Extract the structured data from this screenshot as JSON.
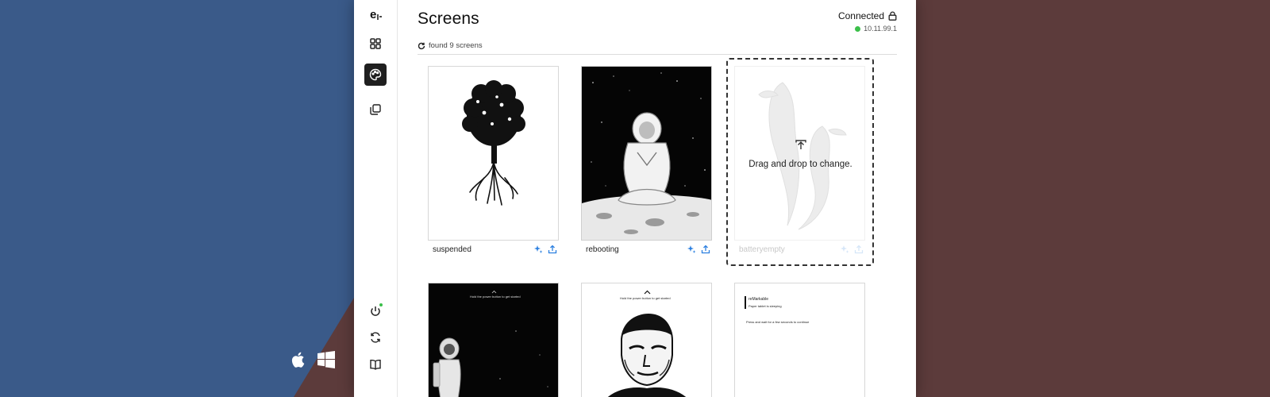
{
  "header": {
    "title": "Screens",
    "connection_status": "Connected",
    "ip_address": "10.11.99.1",
    "found_text": "found 9 screens"
  },
  "sidebar": {
    "items": [
      {
        "name": "logo",
        "icon": "app-logo-icon"
      },
      {
        "name": "dashboard",
        "icon": "grid-icon"
      },
      {
        "name": "screens",
        "icon": "palette-icon",
        "active": true
      },
      {
        "name": "templates",
        "icon": "copy-icon"
      },
      {
        "name": "power",
        "icon": "power-icon"
      },
      {
        "name": "sync",
        "icon": "sync-icon"
      },
      {
        "name": "docs",
        "icon": "book-icon"
      }
    ]
  },
  "screens": [
    {
      "label": "suspended",
      "caption": ""
    },
    {
      "label": "rebooting",
      "caption": ""
    },
    {
      "label": "batteryempty",
      "caption": "",
      "drop_text": "Drag and drop to change."
    },
    {
      "label": "",
      "caption": "Hold the power button to get started"
    },
    {
      "label": "",
      "caption": "Hold the power button to get started"
    },
    {
      "label": "",
      "caption": "reMarkable",
      "subcaption": "Paper tablet is sleeping",
      "note": "Press and wait for a few seconds to continue"
    }
  ],
  "colors": {
    "accent": "#2b7fe0",
    "status_green": "#3bbf4a",
    "background_left": "#3a5a89",
    "background_right": "#5c3b3b"
  }
}
